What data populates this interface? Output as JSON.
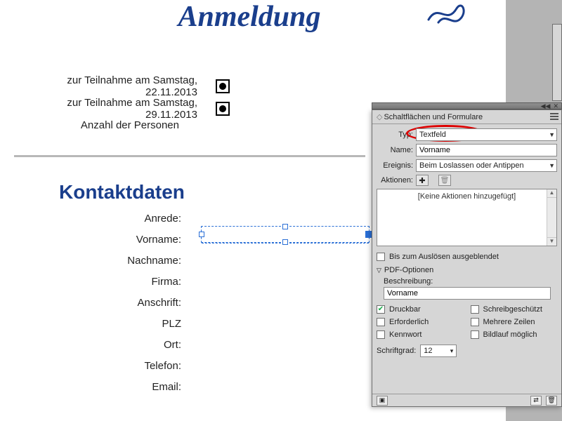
{
  "doc": {
    "title": "Anmeldung",
    "reg1": "zur Teilnahme am Samstag, 22.11.2013",
    "reg2": "zur Teilnahme am Samstag, 29.11.2013",
    "persons": "Anzahl der Personen",
    "section": "Kontaktdaten",
    "labels": {
      "anrede": "Anrede:",
      "vorname": "Vorname:",
      "nachname": "Nachname:",
      "firma": "Firma:",
      "anschrift": "Anschrift:",
      "plz": "PLZ",
      "ort": "Ort:",
      "telefon": "Telefon:",
      "email": "Email:"
    }
  },
  "panel": {
    "title": "Schaltflächen und Formulare",
    "typ_label": "Typ:",
    "typ_value": "Textfeld",
    "name_label": "Name:",
    "name_value": "Vorname",
    "ereignis_label": "Ereignis:",
    "ereignis_value": "Beim Loslassen oder Antippen",
    "aktionen_label": "Aktionen:",
    "no_actions": "[Keine Aktionen hinzugefügt]",
    "hidden_label": "Bis zum Auslösen ausgeblendet",
    "pdf_section": "PDF-Optionen",
    "beschreibung_label": "Beschreibung:",
    "beschreibung_value": "Vorname",
    "druckbar": "Druckbar",
    "erforderlich": "Erforderlich",
    "kennwort": "Kennwort",
    "schreibgeschuetzt": "Schreibgeschützt",
    "mehrere": "Mehrere Zeilen",
    "bildlauf": "Bildlauf möglich",
    "schriftgrad_label": "Schriftgrad:",
    "schriftgrad_value": "12",
    "collapse": "◀◀",
    "close": "✕"
  }
}
